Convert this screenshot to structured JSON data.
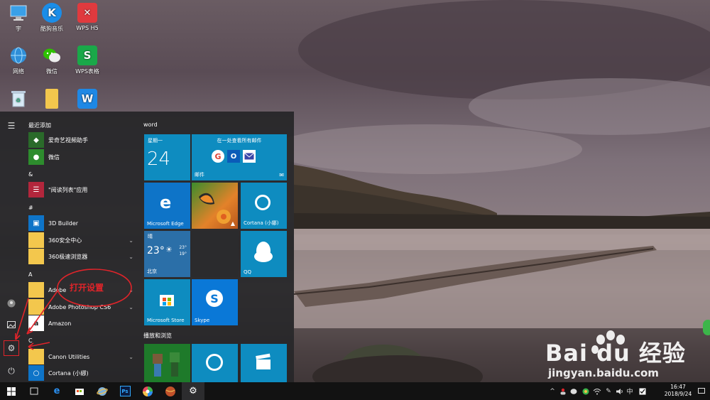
{
  "desktop": {
    "icons": [
      {
        "label": "宇"
      },
      {
        "label": "酷狗音乐"
      },
      {
        "label": "WPS H5"
      },
      {
        "label": "网络"
      },
      {
        "label": "微信"
      },
      {
        "label": "WPS表格"
      },
      {
        "label": ""
      },
      {
        "label": ""
      },
      {
        "label": ""
      }
    ]
  },
  "start_menu": {
    "sections": {
      "recent": "最近添加",
      "amp": "&",
      "hash": "#",
      "a": "A",
      "c": "C"
    },
    "apps": [
      {
        "label": "爱奇艺视频助手"
      },
      {
        "label": "微信"
      },
      {
        "label": "\"阅读列表\"应用"
      },
      {
        "label": "3D Builder"
      },
      {
        "label": "360安全中心"
      },
      {
        "label": "360极速浏览器"
      },
      {
        "label": "Adobe"
      },
      {
        "label": "Adobe Photoshop CS6"
      },
      {
        "label": "Amazon"
      },
      {
        "label": "Canon Utilities"
      },
      {
        "label": "Cortana (小娜)"
      }
    ],
    "tile_groups": {
      "word": "word",
      "play": "播放和浏览"
    },
    "tiles": {
      "calendar_day": "星期一",
      "calendar_date": "24",
      "mail_header": "在一处查看所有邮件",
      "mail_label": "邮件",
      "edge": "Microsoft Edge",
      "cortana": "Cortana (小娜)",
      "weather_cond": "晴",
      "weather_temp": "23°",
      "weather_hi": "23°",
      "weather_lo": "19°",
      "weather_city": "北京",
      "qq": "QQ",
      "store": "Microsoft Store",
      "skype": "Skype"
    }
  },
  "annotation": {
    "text": "打开设置"
  },
  "taskbar": {
    "tray_lang": "中",
    "time": "16:47",
    "date": "2018/9/24"
  },
  "watermark": {
    "brand": "Bai du 经验",
    "url": "jingyan.baidu.com"
  }
}
